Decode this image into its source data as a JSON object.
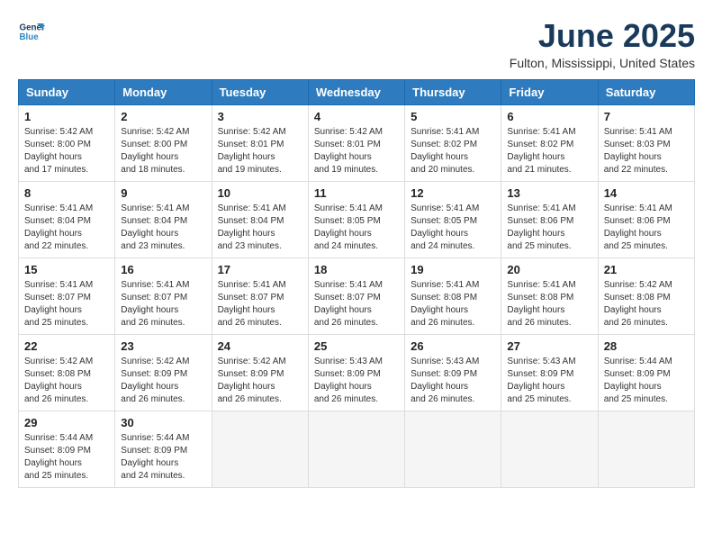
{
  "header": {
    "logo_line1": "General",
    "logo_line2": "Blue",
    "month_title": "June 2025",
    "location": "Fulton, Mississippi, United States"
  },
  "calendar": {
    "days_of_week": [
      "Sunday",
      "Monday",
      "Tuesday",
      "Wednesday",
      "Thursday",
      "Friday",
      "Saturday"
    ],
    "weeks": [
      [
        {
          "day": "",
          "empty": true
        },
        {
          "day": "2",
          "sunrise": "5:42 AM",
          "sunset": "8:00 PM",
          "daylight": "14 hours and 18 minutes."
        },
        {
          "day": "3",
          "sunrise": "5:42 AM",
          "sunset": "8:01 PM",
          "daylight": "14 hours and 19 minutes."
        },
        {
          "day": "4",
          "sunrise": "5:42 AM",
          "sunset": "8:01 PM",
          "daylight": "14 hours and 19 minutes."
        },
        {
          "day": "5",
          "sunrise": "5:41 AM",
          "sunset": "8:02 PM",
          "daylight": "14 hours and 20 minutes."
        },
        {
          "day": "6",
          "sunrise": "5:41 AM",
          "sunset": "8:02 PM",
          "daylight": "14 hours and 21 minutes."
        },
        {
          "day": "7",
          "sunrise": "5:41 AM",
          "sunset": "8:03 PM",
          "daylight": "14 hours and 22 minutes."
        }
      ],
      [
        {
          "day": "1",
          "sunrise": "5:42 AM",
          "sunset": "8:00 PM",
          "daylight": "14 hours and 17 minutes."
        },
        {
          "day": "8",
          "sunrise": "5:41 AM",
          "sunset": "8:04 PM",
          "daylight": "14 hours and 22 minutes."
        },
        {
          "day": "9",
          "sunrise": "5:41 AM",
          "sunset": "8:04 PM",
          "daylight": "14 hours and 23 minutes."
        },
        {
          "day": "10",
          "sunrise": "5:41 AM",
          "sunset": "8:04 PM",
          "daylight": "14 hours and 23 minutes."
        },
        {
          "day": "11",
          "sunrise": "5:41 AM",
          "sunset": "8:05 PM",
          "daylight": "14 hours and 24 minutes."
        },
        {
          "day": "12",
          "sunrise": "5:41 AM",
          "sunset": "8:05 PM",
          "daylight": "14 hours and 24 minutes."
        },
        {
          "day": "13",
          "sunrise": "5:41 AM",
          "sunset": "8:06 PM",
          "daylight": "14 hours and 25 minutes."
        },
        {
          "day": "14",
          "sunrise": "5:41 AM",
          "sunset": "8:06 PM",
          "daylight": "14 hours and 25 minutes."
        }
      ],
      [
        {
          "day": "15",
          "sunrise": "5:41 AM",
          "sunset": "8:07 PM",
          "daylight": "14 hours and 25 minutes."
        },
        {
          "day": "16",
          "sunrise": "5:41 AM",
          "sunset": "8:07 PM",
          "daylight": "14 hours and 26 minutes."
        },
        {
          "day": "17",
          "sunrise": "5:41 AM",
          "sunset": "8:07 PM",
          "daylight": "14 hours and 26 minutes."
        },
        {
          "day": "18",
          "sunrise": "5:41 AM",
          "sunset": "8:07 PM",
          "daylight": "14 hours and 26 minutes."
        },
        {
          "day": "19",
          "sunrise": "5:41 AM",
          "sunset": "8:08 PM",
          "daylight": "14 hours and 26 minutes."
        },
        {
          "day": "20",
          "sunrise": "5:41 AM",
          "sunset": "8:08 PM",
          "daylight": "14 hours and 26 minutes."
        },
        {
          "day": "21",
          "sunrise": "5:42 AM",
          "sunset": "8:08 PM",
          "daylight": "14 hours and 26 minutes."
        }
      ],
      [
        {
          "day": "22",
          "sunrise": "5:42 AM",
          "sunset": "8:08 PM",
          "daylight": "14 hours and 26 minutes."
        },
        {
          "day": "23",
          "sunrise": "5:42 AM",
          "sunset": "8:09 PM",
          "daylight": "14 hours and 26 minutes."
        },
        {
          "day": "24",
          "sunrise": "5:42 AM",
          "sunset": "8:09 PM",
          "daylight": "14 hours and 26 minutes."
        },
        {
          "day": "25",
          "sunrise": "5:43 AM",
          "sunset": "8:09 PM",
          "daylight": "14 hours and 26 minutes."
        },
        {
          "day": "26",
          "sunrise": "5:43 AM",
          "sunset": "8:09 PM",
          "daylight": "14 hours and 26 minutes."
        },
        {
          "day": "27",
          "sunrise": "5:43 AM",
          "sunset": "8:09 PM",
          "daylight": "14 hours and 25 minutes."
        },
        {
          "day": "28",
          "sunrise": "5:44 AM",
          "sunset": "8:09 PM",
          "daylight": "14 hours and 25 minutes."
        }
      ],
      [
        {
          "day": "29",
          "sunrise": "5:44 AM",
          "sunset": "8:09 PM",
          "daylight": "14 hours and 25 minutes."
        },
        {
          "day": "30",
          "sunrise": "5:44 AM",
          "sunset": "8:09 PM",
          "daylight": "14 hours and 24 minutes."
        },
        {
          "day": "",
          "empty": true
        },
        {
          "day": "",
          "empty": true
        },
        {
          "day": "",
          "empty": true
        },
        {
          "day": "",
          "empty": true
        },
        {
          "day": "",
          "empty": true
        }
      ]
    ]
  }
}
